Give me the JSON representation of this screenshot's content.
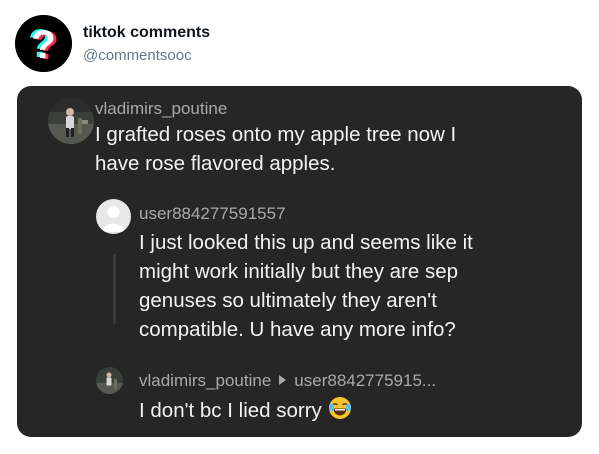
{
  "header": {
    "account_name": "tiktok comments",
    "account_handle": "@commentsooc",
    "avatar_icon": "tiktok-question-mark-icon"
  },
  "comments": [
    {
      "username": "vladimirs_poutine",
      "text_lines": [
        "I grafted roses onto my apple tree now I",
        "have rose flavored apples."
      ]
    },
    {
      "username": "user884277591557",
      "text_lines": [
        "I just looked this up and seems like it",
        "might work initially but they are sep",
        "genuses so ultimately they aren't",
        "compatible. U have any more info?"
      ]
    },
    {
      "username": "vladimirs_poutine",
      "reply_to": "user8842775915...",
      "text": "I don't bc I lied sorry",
      "emoji": "laughing-tears-emoji"
    }
  ],
  "colors": {
    "card_background": "#262626",
    "username": "#a9a9a9",
    "comment_text": "#f2f2f2",
    "handle": "#657786"
  }
}
